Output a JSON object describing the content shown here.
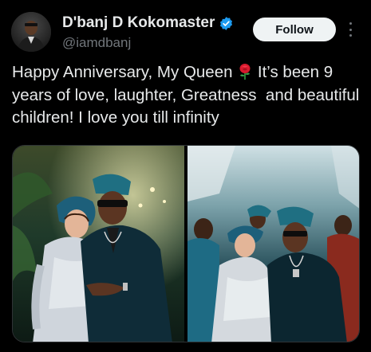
{
  "author": {
    "display_name": "D'banj D Kokomaster",
    "handle": "@iamdbanj",
    "verified": true
  },
  "actions": {
    "follow_label": "Follow"
  },
  "tweet": {
    "text_before_emoji": "Happy Anniversary, My Queen ",
    "text_after_emoji": " It’s been 9 years of love, laughter, Greatness  and beautiful children! I love you till infinity"
  },
  "colors": {
    "background": "#000000",
    "primary_text": "#e7e9ea",
    "secondary_text": "#71767b",
    "verified_blue": "#1d9bf0",
    "follow_bg": "#eff3f4"
  },
  "icons": {
    "verified": "verified-badge-icon",
    "more": "more-options-icon",
    "emoji": "rose-emoji"
  },
  "media": [
    {
      "name": "anniversary-photo-left"
    },
    {
      "name": "anniversary-photo-right"
    }
  ]
}
